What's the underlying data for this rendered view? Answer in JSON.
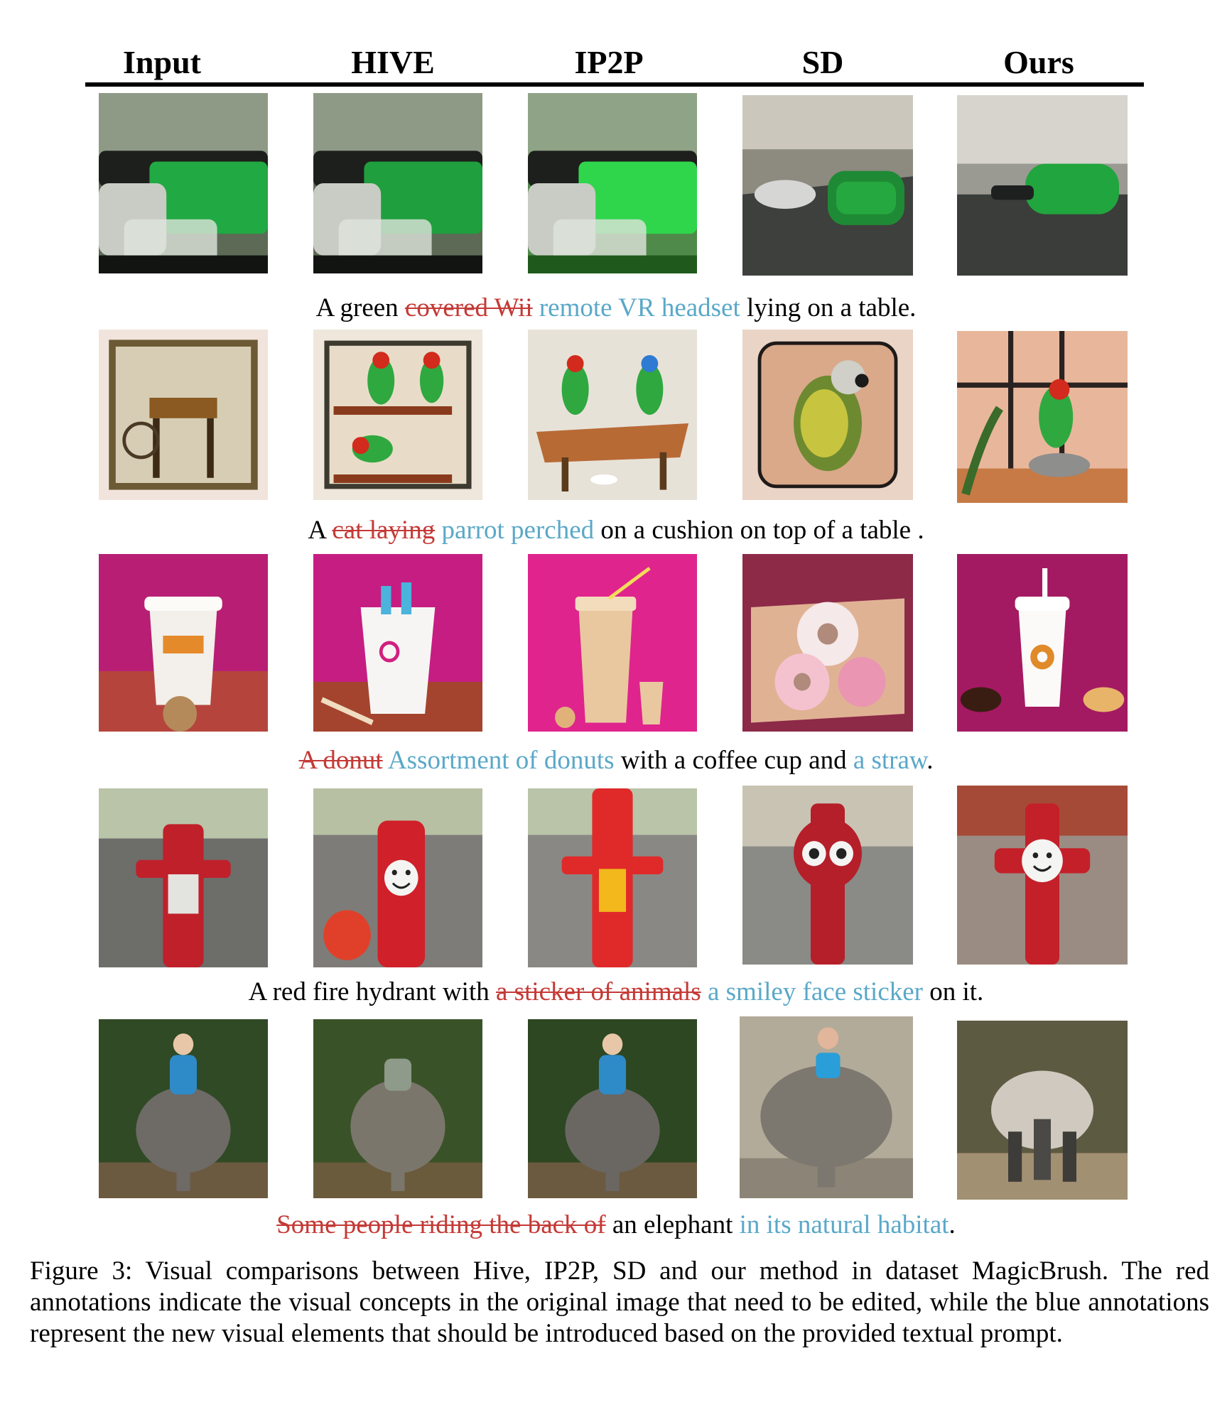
{
  "columns": [
    "Input",
    "HIVE",
    "IP2P",
    "SD",
    "Ours"
  ],
  "rows": [
    {
      "prompt": [
        {
          "text": "A green ",
          "kind": "keep"
        },
        {
          "text": "covered Wii",
          "kind": "del"
        },
        {
          "text": " ",
          "kind": "keep"
        },
        {
          "text": "remote VR headset",
          "kind": "add"
        },
        {
          "text": " lying on a table.",
          "kind": "keep"
        }
      ],
      "images": [
        {
          "label": "green covered Wii remote on table"
        },
        {
          "label": "green covered Wii remote on table"
        },
        {
          "label": "bright green covered Wii remote"
        },
        {
          "label": "green VR headset and mouse on table"
        },
        {
          "label": "green VR headset on table"
        }
      ]
    },
    {
      "prompt": [
        {
          "text": "A ",
          "kind": "keep"
        },
        {
          "text": "cat laying",
          "kind": "del"
        },
        {
          "text": " ",
          "kind": "keep"
        },
        {
          "text": "parrot perched",
          "kind": "add"
        },
        {
          "text": " on a cushion on top of a table .",
          "kind": "keep"
        }
      ],
      "images": [
        {
          "label": "vintage photo of a cat on a table"
        },
        {
          "label": "parrots on shelves"
        },
        {
          "label": "two parrots on a table"
        },
        {
          "label": "parrot on a cushion"
        },
        {
          "label": "parrot perched on a cushion by a window"
        }
      ]
    },
    {
      "prompt": [
        {
          "text": "A donut",
          "kind": "del"
        },
        {
          "text": " ",
          "kind": "keep"
        },
        {
          "text": "Assortment of donuts",
          "kind": "add"
        },
        {
          "text": " with a coffee cup and ",
          "kind": "keep"
        },
        {
          "text": "a straw",
          "kind": "add"
        },
        {
          "text": ".",
          "kind": "keep"
        }
      ],
      "images": [
        {
          "label": "coffee cup on pink background"
        },
        {
          "label": "white cup with straws"
        },
        {
          "label": "coffee cup with straw and donuts"
        },
        {
          "label": "box of sprinkled donuts"
        },
        {
          "label": "coffee cup with straw and donuts"
        }
      ]
    },
    {
      "prompt": [
        {
          "text": "A red fire hydrant with ",
          "kind": "keep"
        },
        {
          "text": "a sticker of animals",
          "kind": "del"
        },
        {
          "text": " ",
          "kind": "keep"
        },
        {
          "text": "a smiley face sticker",
          "kind": "add"
        },
        {
          "text": " on it.",
          "kind": "keep"
        }
      ],
      "images": [
        {
          "label": "red fire hydrant with animal sticker"
        },
        {
          "label": "red fire hydrant with smiley face"
        },
        {
          "label": "red fire hydrant with face sticker"
        },
        {
          "label": "red fire hydrant with eyes"
        },
        {
          "label": "red fire hydrant with smiley face sticker"
        }
      ]
    },
    {
      "prompt": [
        {
          "text": "Some people riding the back of",
          "kind": "del"
        },
        {
          "text": " an elephant ",
          "kind": "keep"
        },
        {
          "text": "in its natural habitat",
          "kind": "add"
        },
        {
          "text": ".",
          "kind": "keep"
        }
      ],
      "images": [
        {
          "label": "people riding an elephant"
        },
        {
          "label": "elephant with rider in forest"
        },
        {
          "label": "people riding an elephant"
        },
        {
          "label": "man riding an elephant"
        },
        {
          "label": "elephant in natural habitat"
        }
      ]
    }
  ],
  "figure_caption": "Figure 3: Visual comparisons between Hive, IP2P, SD and our method in dataset MagicBrush. The red annotations indicate the visual concepts in the original image that need to be edited, while the blue annotations represent the new visual elements that should be introduced based on the provided textual prompt.",
  "colors": {
    "deleted": "#c43a36",
    "added": "#5aa8c8"
  }
}
